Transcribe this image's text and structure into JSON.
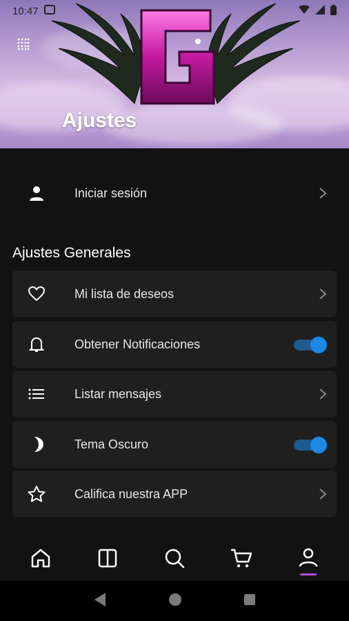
{
  "status_bar": {
    "time": "10:47"
  },
  "header": {
    "title": "Ajustes",
    "logo_letter": "G"
  },
  "login": {
    "label": "Iniciar sesión",
    "icon": "person-icon"
  },
  "general": {
    "section_title": "Ajustes Generales",
    "items": [
      {
        "label": "Mi lista de deseos",
        "icon": "heart-icon",
        "control": "chevron"
      },
      {
        "label": "Obtener Notificaciones",
        "icon": "bell-icon",
        "control": "toggle",
        "enabled": true
      },
      {
        "label": "Listar mensajes",
        "icon": "list-icon",
        "control": "chevron"
      },
      {
        "label": "Tema Oscuro",
        "icon": "moon-icon",
        "control": "toggle",
        "enabled": true
      },
      {
        "label": "Califica nuestra APP",
        "icon": "star-icon",
        "control": "chevron"
      }
    ]
  },
  "bottom_nav": {
    "items": [
      "home-icon",
      "book-icon",
      "search-icon",
      "cart-icon",
      "profile-icon"
    ],
    "active": "profile-icon",
    "accent_color": "#b04de0"
  },
  "colors": {
    "background": "#121212",
    "card": "#1f1f1f",
    "toggle": "#1e88e5"
  }
}
